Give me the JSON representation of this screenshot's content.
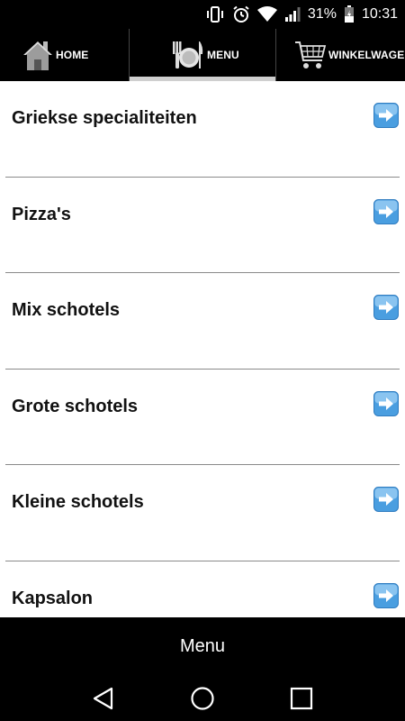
{
  "status_bar": {
    "battery_percent": "31%",
    "time": "10:31",
    "icons": [
      "vibrate-icon",
      "alarm-icon",
      "wifi-icon",
      "signal-icon",
      "battery-icon"
    ]
  },
  "top_nav": {
    "tabs": [
      {
        "label": "HOME",
        "icon": "house-icon"
      },
      {
        "label": "MENU",
        "icon": "plate-cutlery-icon",
        "active": true
      },
      {
        "label": "WINKELWAGEN",
        "icon": "cart-icon"
      }
    ]
  },
  "categories": [
    {
      "label": "Griekse specialiteiten"
    },
    {
      "label": "Pizza's"
    },
    {
      "label": "Mix schotels"
    },
    {
      "label": "Grote schotels"
    },
    {
      "label": "Kleine schotels"
    },
    {
      "label": "Kapsalon"
    }
  ],
  "bottom_bar": {
    "title": "Menu"
  },
  "colors": {
    "accent_arrow": "#4a9ee0",
    "background": "#000000",
    "list_bg": "#ffffff"
  }
}
